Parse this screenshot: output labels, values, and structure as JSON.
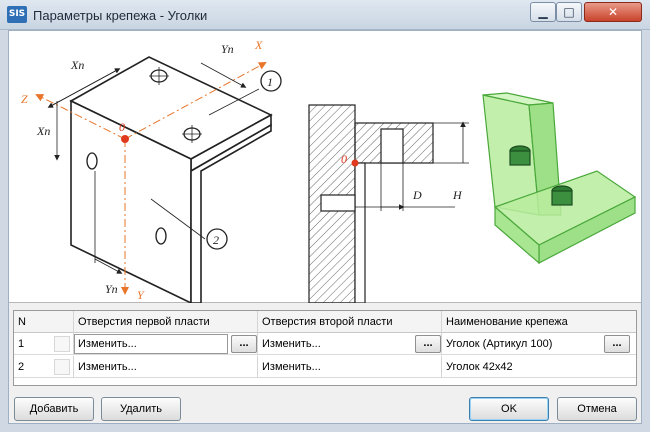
{
  "window": {
    "app_icon_text": "SIS",
    "title": "Параметры крепежа - Уголки",
    "minimize_glyph": "▁",
    "maximize_glyph": "□",
    "close_glyph": "✕"
  },
  "drawing": {
    "labels": {
      "z": "Z",
      "x": "X",
      "y": "Y",
      "xn_top": "Xn",
      "yn_top": "Yn",
      "xn_left": "Xn",
      "yn_bottom": "Yn",
      "origin": "0",
      "callout_1": "1",
      "callout_2": "2",
      "section_origin": "0",
      "dim_d": "D",
      "dim_h": "H"
    }
  },
  "table": {
    "headers": {
      "n": "N",
      "holes_first": "Отверстия первой пласти",
      "holes_second": "Отверстия второй пласти",
      "fastener_name": "Наименование крепежа"
    },
    "rows": [
      {
        "n": "1",
        "holes_first": "Изменить...",
        "holes_second": "Изменить...",
        "fastener_name": "Уголок (Артикул 100)"
      },
      {
        "n": "2",
        "holes_first": "Изменить...",
        "holes_second": "Изменить...",
        "fastener_name": "Уголок 42x42"
      }
    ],
    "browse_label": "..."
  },
  "buttons": {
    "add": "Добавить",
    "delete": "Удалить",
    "ok": "OK",
    "cancel": "Отмена"
  },
  "colors": {
    "axis_orange": "#e8752a",
    "origin_red": "#e03a1e",
    "model_green": "#8fdc7a"
  }
}
